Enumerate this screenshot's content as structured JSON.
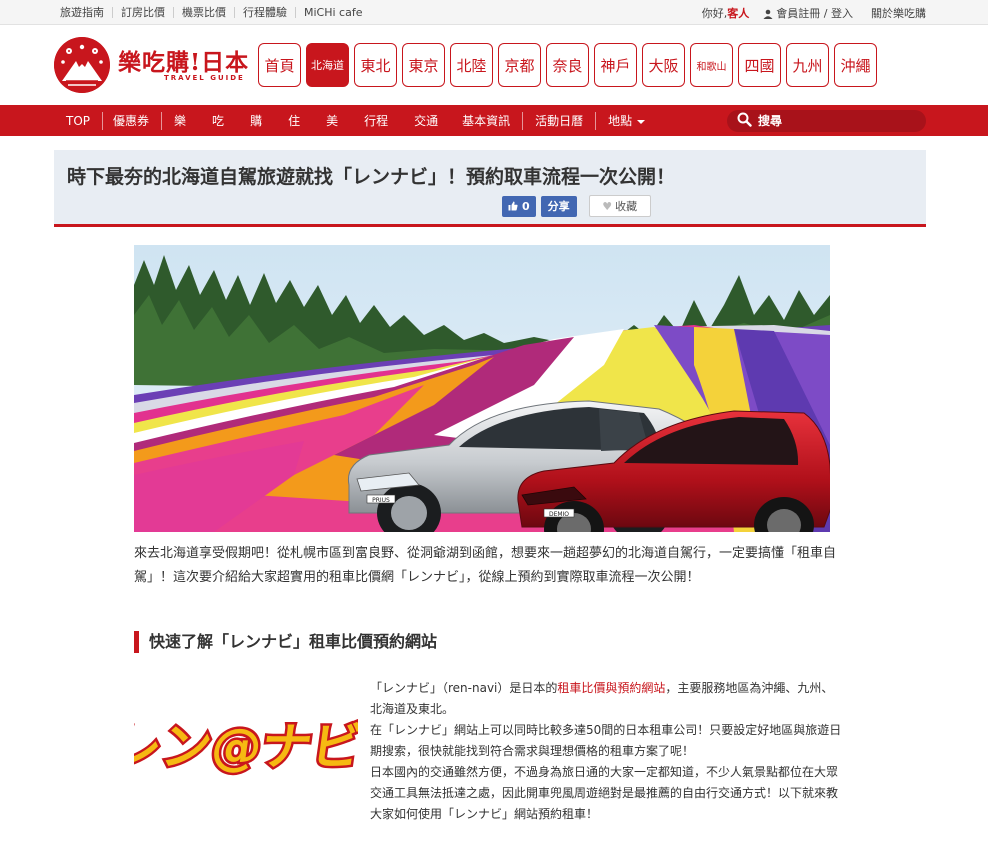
{
  "topbar": {
    "links": [
      "旅遊指南",
      "訂房比價",
      "機票比價",
      "行程體驗",
      "MiCHi cafe"
    ],
    "greeting": "你好,",
    "guest": "客人",
    "account": "會員註冊 / 登入",
    "about": "關於樂吃購"
  },
  "logo": {
    "title": "樂吃購!日本",
    "subtitle": "TRAVEL GUIDE"
  },
  "regions": [
    "首頁",
    "北海道",
    "東北",
    "東京",
    "北陸",
    "京都",
    "奈良",
    "神戶",
    "大阪",
    "和歌山",
    "四國",
    "九州",
    "沖繩"
  ],
  "active_region": "北海道",
  "nav": {
    "items": [
      "TOP",
      "優惠券",
      "樂",
      "吃",
      "購",
      "住",
      "美",
      "行程",
      "交通",
      "基本資訊",
      "活動日曆",
      "地點"
    ],
    "search_placeholder": "搜尋"
  },
  "article": {
    "title": "時下最夯的北海道自駕旅遊就找「レンナビ」！預約取車流程一次公開！",
    "like_count": "0",
    "share_label": "分享",
    "favorite_label": "收藏",
    "intro": "來去北海道享受假期吧！從札幌市區到富良野、從洞爺湖到函館，想要來一趟超夢幻的北海道自駕行，一定要搞懂「租車自駕」！這次要介紹給大家超實用的租車比價網「レンナビ」，從線上預約到實際取車流程一次公開！",
    "section_title": "快速了解「レンナビ」租車比價預約網站",
    "logo_text": "レン@ナビ",
    "car_badges": [
      "PRIUS",
      "DEMIO"
    ],
    "desc_p1_a": "「レンナビ」（ren-navi）是日本的",
    "desc_p1_link": "租車比價與預約網站",
    "desc_p1_b": "，主要服務地區為沖繩、九州、北海道及東北。",
    "desc_p2": "在「レンナビ」網站上可以同時比較多達50間的日本租車公司！只要設定好地區與旅遊日期搜索，很快就能找到符合需求與理想價格的租車方案了呢！",
    "desc_p3": "日本國內的交通雖然方便，不過身為旅日通的大家一定都知道，不少人氣景點都位在大眾交通工具無法抵達之處，因此開車兜風周遊絕對是最推薦的自由行交通方式！以下就來教大家如何使用「レンナビ」網站預約租車！"
  },
  "colors": {
    "brand_red": "#c8161d",
    "facebook_blue": "#4267b2"
  }
}
